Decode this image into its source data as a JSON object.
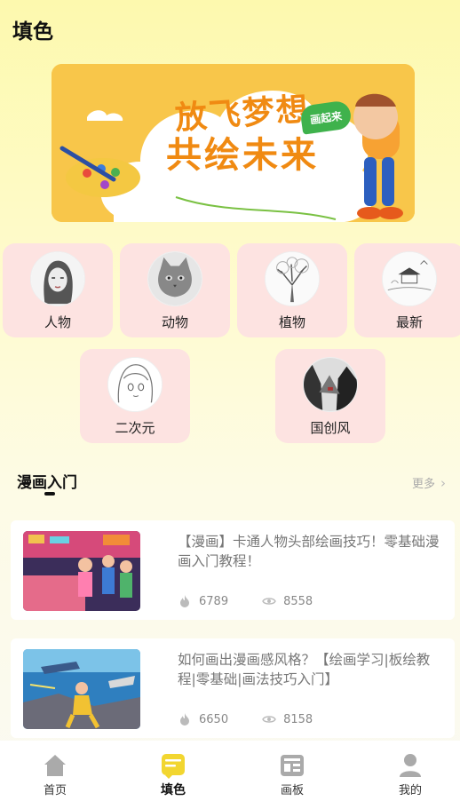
{
  "page": {
    "title": "填色"
  },
  "banner": {
    "line1": "放飞梦想",
    "line2": "共绘未来",
    "badge": "画起来"
  },
  "categories": [
    {
      "label": "人物",
      "icon": "portrait-sketch-icon"
    },
    {
      "label": "动物",
      "icon": "cat-sketch-icon"
    },
    {
      "label": "植物",
      "icon": "tree-sketch-icon"
    },
    {
      "label": "最新",
      "icon": "pavilion-sketch-icon"
    },
    {
      "label": "二次元",
      "icon": "anime-girl-sketch-icon"
    },
    {
      "label": "国创风",
      "icon": "ink-landscape-icon"
    }
  ],
  "section": {
    "title": "漫画入门",
    "more": "更多"
  },
  "articles": [
    {
      "title": "【漫画】卡通人物头部绘画技巧！零基础漫画入门教程！",
      "likes": "6789",
      "views": "8558"
    },
    {
      "title": "如何画出漫画感风格？【绘画学习|板绘教程|零基础|画法技巧入门】",
      "likes": "6650",
      "views": "8158"
    }
  ],
  "nav": [
    {
      "label": "首页",
      "icon": "home-icon"
    },
    {
      "label": "填色",
      "icon": "coloring-icon"
    },
    {
      "label": "画板",
      "icon": "board-icon"
    },
    {
      "label": "我的",
      "icon": "user-icon"
    }
  ],
  "colors": {
    "accent": "#f8c64a",
    "cardPink": "#fde3e1",
    "navActive": "#f2d630"
  }
}
